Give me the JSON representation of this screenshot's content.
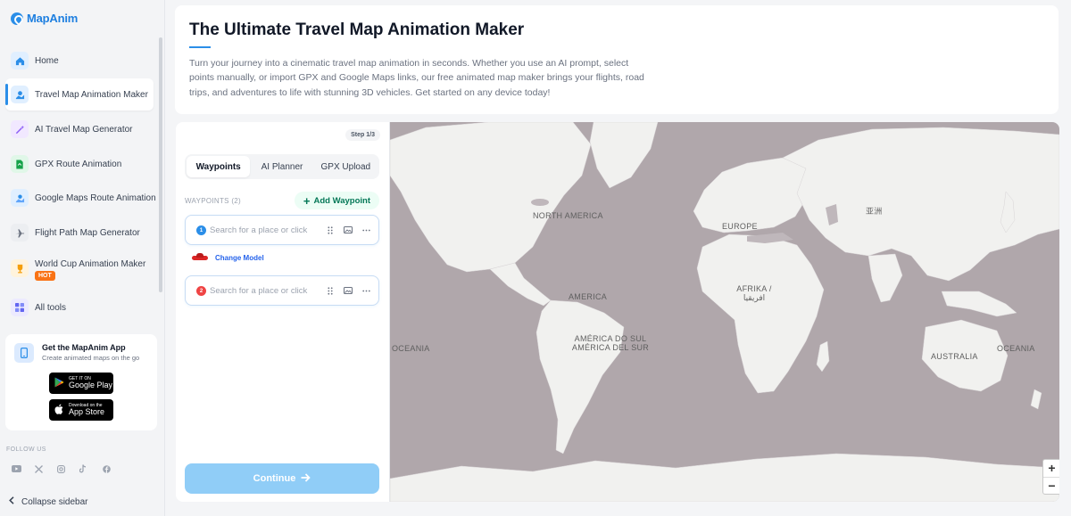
{
  "brand": {
    "name": "MapAnim"
  },
  "sidebar": {
    "items": [
      {
        "label": "Home",
        "icon": "home-icon",
        "color": "#2b8ee8",
        "bg": "#e0efff"
      },
      {
        "label": "Travel Map Animation Maker",
        "icon": "map-pin-icon",
        "color": "#2b8ee8",
        "bg": "#e0efff",
        "active": true
      },
      {
        "label": "AI Travel Map Generator",
        "icon": "magic-wand-icon",
        "color": "#8b5cf6",
        "bg": "#f1e8ff"
      },
      {
        "label": "GPX Route Animation",
        "icon": "gpx-file-icon",
        "color": "#16a34a",
        "bg": "#e0f7e8"
      },
      {
        "label": "Google Maps Route Animation",
        "icon": "route-icon",
        "color": "#2b8ee8",
        "bg": "#e0efff"
      },
      {
        "label": "Flight Path Map Generator",
        "icon": "plane-icon",
        "color": "#6b7280",
        "bg": "#eceef1"
      },
      {
        "label": "World Cup Animation Maker",
        "icon": "trophy-icon",
        "color": "#f59e0b",
        "bg": "#fff3dc",
        "badge": "HOT"
      },
      {
        "label": "All tools",
        "icon": "grid-icon",
        "color": "#6366f1",
        "bg": "#eceaff"
      }
    ],
    "app_card": {
      "title": "Get the MapAnim App",
      "subtitle": "Create animated maps on the go",
      "google_play": {
        "small": "GET IT ON",
        "big": "Google Play"
      },
      "app_store": {
        "small": "Download on the",
        "big": "App Store"
      }
    },
    "follow_label": "FOLLOW US",
    "socials": [
      "youtube-icon",
      "x-icon",
      "instagram-icon",
      "tiktok-icon",
      "facebook-icon"
    ],
    "collapse_label": "Collapse sidebar"
  },
  "header": {
    "title": "The Ultimate Travel Map Animation Maker",
    "description": "Turn your journey into a cinematic travel map animation in seconds. Whether you use an AI prompt, select points manually, or import GPX and Google Maps links, our free animated map maker brings your flights, road trips, and adventures to life with stunning 3D vehicles. Get started on any device today!"
  },
  "panel": {
    "step": "Step 1/3",
    "tabs": [
      "Waypoints",
      "AI Planner",
      "GPX Upload"
    ],
    "active_tab": 0,
    "waypoints_header": "WAYPOINTS (2)",
    "add_waypoint_label": "Add Waypoint",
    "waypoints": [
      {
        "number": "1",
        "color": "#2b8ee8",
        "placeholder": "Search for a place or click",
        "value": ""
      },
      {
        "number": "2",
        "color": "#ef4444",
        "placeholder": "Search for a place or click",
        "value": ""
      }
    ],
    "change_model_label": "Change Model",
    "continue_label": "Continue"
  },
  "map": {
    "labels": [
      "NORTH AMERICA",
      "EUROPE",
      "亚洲",
      "AMERICA",
      "AFRIKA / افريقيا",
      "AMÉRICA DO SUL AMÉRICA DEL SUR",
      "OCEANIA",
      "AUSTRALIA",
      "OCEANIA"
    ],
    "zoom_in": "+",
    "zoom_out": "−"
  },
  "colors": {
    "accent": "#2b8ee8",
    "ocean": "#b0a7ab",
    "land": "#f1f1ef",
    "continue_disabled": "#90cdf7"
  }
}
